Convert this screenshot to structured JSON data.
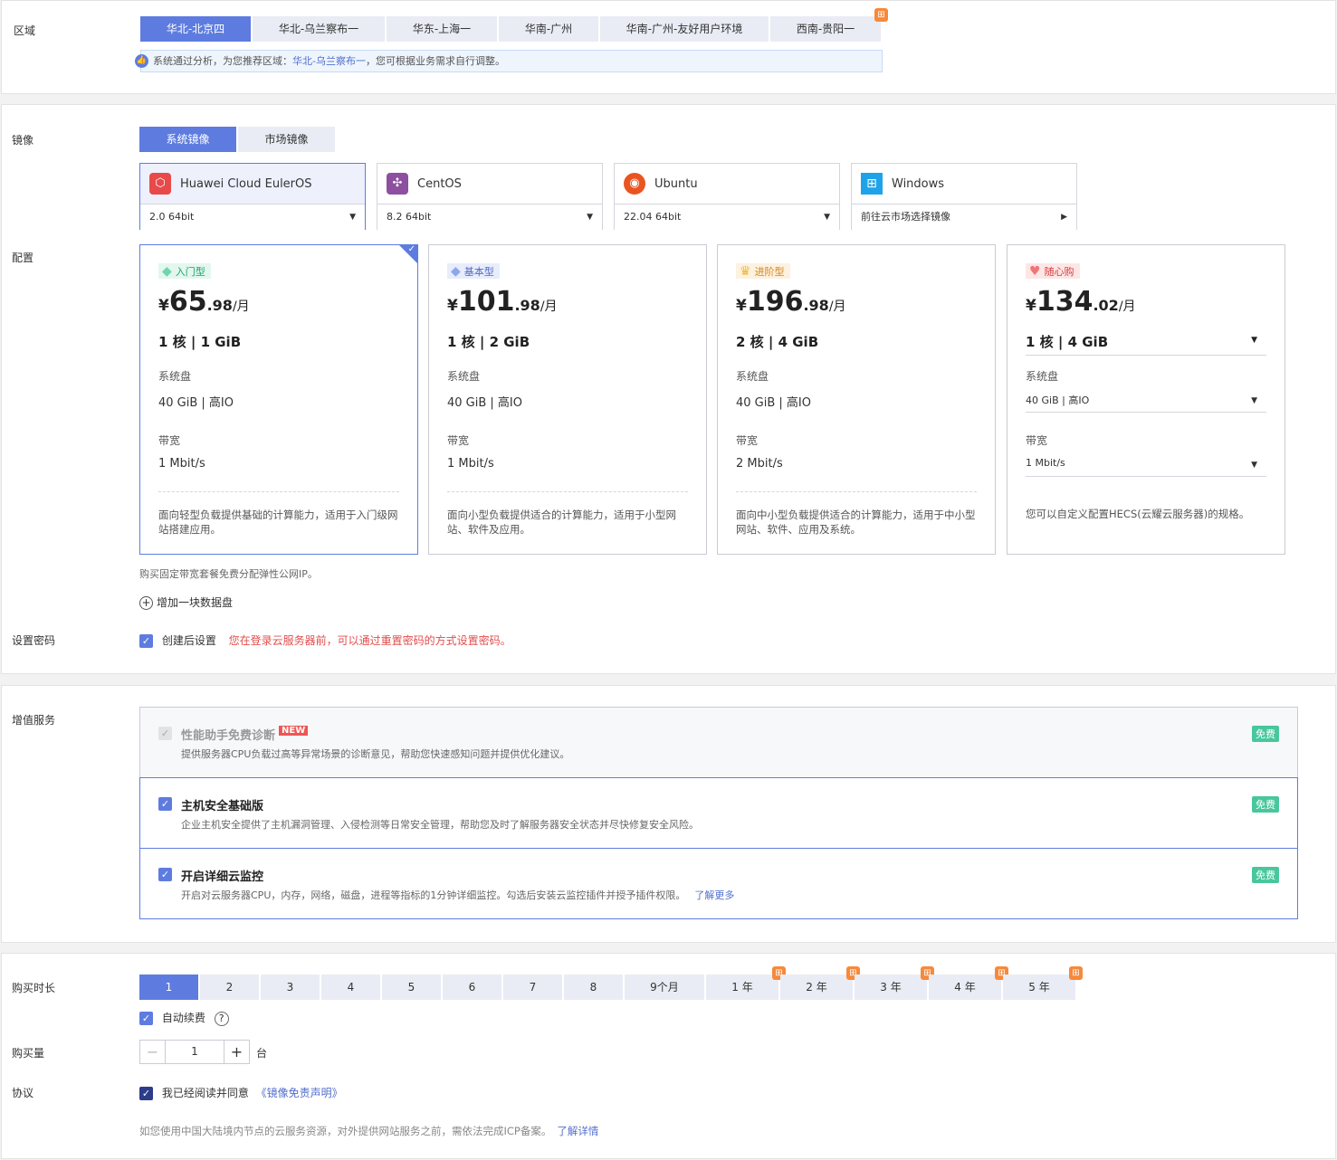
{
  "region": {
    "label": "区域",
    "tabs": [
      "华北-北京四",
      "华北-乌兰察布一",
      "华东-上海一",
      "华南-广州",
      "华南-广州-友好用户环境",
      "西南-贵阳一"
    ],
    "tip_prefix": "系统通过分析，为您推荐区域：",
    "tip_link": "华北-乌兰察布一",
    "tip_suffix": "，您可根据业务需求自行调整。"
  },
  "image": {
    "label": "镜像",
    "tabs": [
      "系统镜像",
      "市场镜像"
    ],
    "os": [
      {
        "name": "Huawei Cloud EulerOS",
        "version": "2.0 64bit"
      },
      {
        "name": "CentOS",
        "version": "8.2 64bit"
      },
      {
        "name": "Ubuntu",
        "version": "22.04 64bit"
      },
      {
        "name": "Windows",
        "version": "前往云市场选择镜像"
      }
    ]
  },
  "config": {
    "label": "配置",
    "disk_label": "系统盘",
    "bw_label": "带宽",
    "cards": [
      {
        "badge": "入门型",
        "cur": "¥",
        "int": "65",
        "dec": ".98",
        "unit": "/月",
        "spec": "1 核 | 1 GiB",
        "disk": "40 GiB | 高IO",
        "bw": "1 Mbit/s",
        "desc": "面向轻型负载提供基础的计算能力，适用于入门级网站搭建应用。"
      },
      {
        "badge": "基本型",
        "cur": "¥",
        "int": "101",
        "dec": ".98",
        "unit": "/月",
        "spec": "1 核 | 2 GiB",
        "disk": "40 GiB | 高IO",
        "bw": "1 Mbit/s",
        "desc": "面向小型负载提供适合的计算能力，适用于小型网站、软件及应用。"
      },
      {
        "badge": "进阶型",
        "cur": "¥",
        "int": "196",
        "dec": ".98",
        "unit": "/月",
        "spec": "2 核 | 4 GiB",
        "disk": "40 GiB | 高IO",
        "bw": "2 Mbit/s",
        "desc": "面向中小型负载提供适合的计算能力，适用于中小型网站、软件、应用及系统。"
      },
      {
        "badge": "随心购",
        "cur": "¥",
        "int": "134",
        "dec": ".02",
        "unit": "/月",
        "spec": "1 核 | 4 GiB",
        "disk": "40 GiB | 高IO",
        "bw": "1 Mbit/s",
        "desc": "您可以自定义配置HECS(云耀云服务器)的规格。"
      }
    ],
    "ip_note": "购买固定带宽套餐免费分配弹性公网IP。",
    "add_disk": "增加一块数据盘"
  },
  "password": {
    "label": "设置密码",
    "option": "创建后设置",
    "warning": "您在登录云服务器前，可以通过重置密码的方式设置密码。"
  },
  "vas": {
    "label": "增值服务",
    "free": "免费",
    "new_badge": "NEW",
    "items": [
      {
        "title": "性能助手免费诊断",
        "desc": "提供服务器CPU负载过高等异常场景的诊断意见，帮助您快速感知问题并提供优化建议。"
      },
      {
        "title": "主机安全基础版",
        "desc": "企业主机安全提供了主机漏洞管理、入侵检测等日常安全管理，帮助您及时了解服务器安全状态并尽快修复安全风险。"
      },
      {
        "title": "开启详细云监控",
        "desc": "开启对云服务器CPU，内存，网络，磁盘，进程等指标的1分钟详细监控。勾选后安装云监控插件并授予插件权限。",
        "link": "了解更多"
      }
    ]
  },
  "duration": {
    "label": "购买时长",
    "options": [
      "1",
      "2",
      "3",
      "4",
      "5",
      "6",
      "7",
      "8",
      "9个月",
      "1 年",
      "2 年",
      "3 年",
      "4 年",
      "5 年"
    ],
    "auto_renew": "自动续费"
  },
  "quantity": {
    "label": "购买量",
    "value": "1",
    "unit": "台"
  },
  "agreement": {
    "label": "协议",
    "text": "我已经阅读并同意",
    "link": "《镜像免责声明》",
    "icp_note": "如您使用中国大陆境内节点的云服务资源，对外提供网站服务之前，需依法完成ICP备案。",
    "icp_link": "了解详情"
  },
  "colors": {
    "accent": "#5e7ce0",
    "free": "#48c79c",
    "warning": "#e24c4c",
    "gift": "#f7893b"
  }
}
